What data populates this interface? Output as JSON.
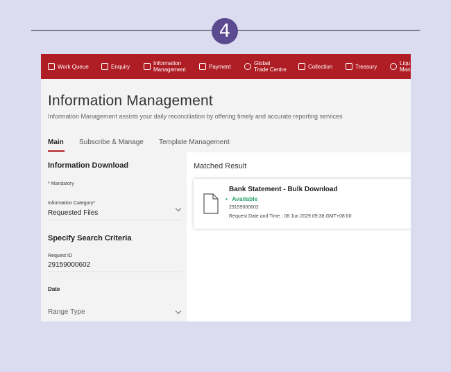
{
  "step": {
    "number": "4"
  },
  "nav": {
    "items": [
      {
        "label": "Work Queue",
        "icon": "briefcase-icon"
      },
      {
        "label": "Enquiry",
        "icon": "magnifier-icon"
      },
      {
        "label": "Information\nManagement",
        "icon": "folder-icon"
      },
      {
        "label": "Payment",
        "icon": "wallet-icon"
      },
      {
        "label": "Global\nTrade Centre",
        "icon": "globe-icon"
      },
      {
        "label": "Collection",
        "icon": "cash-icon"
      },
      {
        "label": "Treasury",
        "icon": "bank-icon"
      },
      {
        "label": "Liqu\nMan",
        "icon": "dollar-circle-icon"
      }
    ]
  },
  "header": {
    "title": "Information Management",
    "subtitle": "Information Management assists your daily reconciliation by offering timely and accurate reporting services",
    "tabs": [
      "Main",
      "Subscribe & Manage",
      "Template Management"
    ]
  },
  "left": {
    "heading": "Information Download",
    "mandatory": "* Mandatory",
    "category_label": "Information Category*",
    "category_value": "Requested Files",
    "criteria_heading": "Specify Search Criteria",
    "request_id_label": "Request ID",
    "request_id_value": "29159000602",
    "date_label": "Date",
    "range_type": "Range Type"
  },
  "result": {
    "heading": "Matched Result",
    "card_title": "Bank Statement - Bulk Download",
    "status_dot": "•",
    "status": "Available",
    "id": "29159000602",
    "request_date": "Request Date and Time : 08 Jun 2029 09:38 GMT+08:00"
  },
  "colors": {
    "brand_red": "#b01e25",
    "available_green": "#2aa56b",
    "step_purple": "#5b4a8f"
  }
}
